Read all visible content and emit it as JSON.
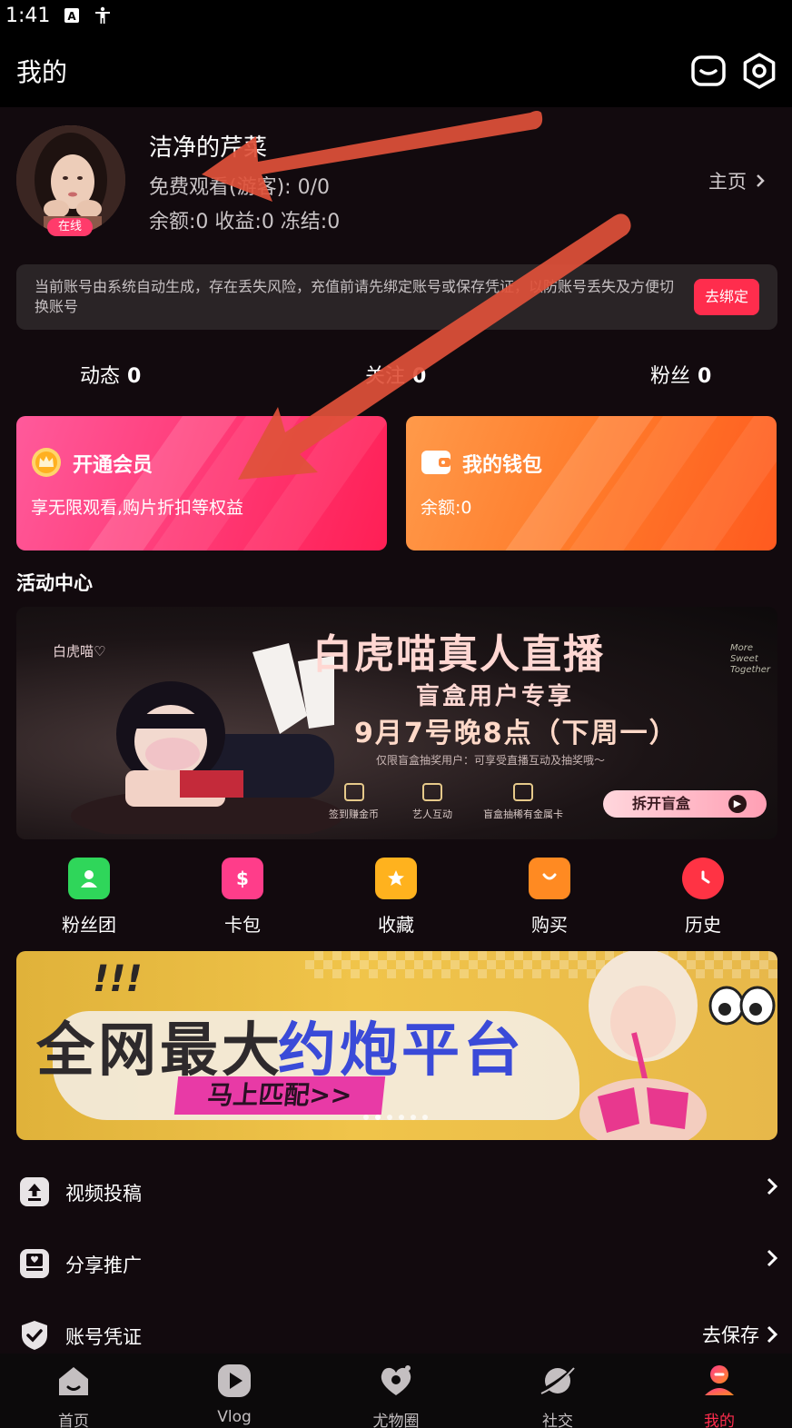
{
  "status_bar": {
    "time": "1:41"
  },
  "header": {
    "title": "我的"
  },
  "profile": {
    "nickname": "洁净的芹菜",
    "online_badge": "在线",
    "free_watch": "免费观看(游客): 0/0",
    "balance_line": "余额:0 收益:0 冻结:0",
    "homepage_label": "主页"
  },
  "notice": {
    "text": "当前账号由系统自动生成，存在丢失风险，充值前请先绑定账号或保存凭证，以防账号丢失及方便切换账号",
    "bind_label": "去绑定"
  },
  "stats": [
    {
      "label": "动态",
      "value": "0"
    },
    {
      "label": "关注",
      "value": "0"
    },
    {
      "label": "粉丝",
      "value": "0"
    }
  ],
  "vip_card": {
    "title": "开通会员",
    "subtitle": "享无限观看,购片折扣等权益"
  },
  "wallet_card": {
    "title": "我的钱包",
    "subtitle": "余额:0"
  },
  "activity": {
    "section_title": "活动中心",
    "banner1": {
      "title": "白虎喵真人直播",
      "subtitle": "盲盒用户专享",
      "date": "9月7号晚8点（下周一）",
      "note": "仅限盲盒抽奖用户：可享受直播互动及抽奖哦～",
      "features": [
        "签到赚金币",
        "艺人互动",
        "盲盒抽稀有金属卡"
      ],
      "button": "拆开盲盒",
      "side_script": "白虎喵♡",
      "side_script2": "More Sweet Together"
    }
  },
  "shortcuts": [
    {
      "label": "粉丝团",
      "icon": "fan-group-icon",
      "color": "#2fd65a"
    },
    {
      "label": "卡包",
      "icon": "card-wallet-icon",
      "color": "#ff3d8a"
    },
    {
      "label": "收藏",
      "icon": "favorite-icon",
      "color": "#ffb21e"
    },
    {
      "label": "购买",
      "icon": "shopping-bag-icon",
      "color": "#ff8a22"
    },
    {
      "label": "历史",
      "icon": "history-icon",
      "color": "#ff3344"
    }
  ],
  "banner2": {
    "text_left": "全网最大",
    "text_right": "约炮平台",
    "button": "马上匹配>>",
    "exclaim": "!!!",
    "slides": 6,
    "active_slide": 1
  },
  "menu": [
    {
      "label": "视频投稿",
      "icon": "upload-icon",
      "right": ""
    },
    {
      "label": "分享推广",
      "icon": "share-icon",
      "right": ""
    },
    {
      "label": "账号凭证",
      "icon": "shield-check-icon",
      "right": "去保存"
    }
  ],
  "tabbar": [
    {
      "label": "首页",
      "icon": "home-icon"
    },
    {
      "label": "Vlog",
      "icon": "play-icon"
    },
    {
      "label": "尤物圈",
      "icon": "heart-circle-icon"
    },
    {
      "label": "社交",
      "icon": "planet-icon"
    },
    {
      "label": "我的",
      "icon": "profile-icon",
      "active": true
    }
  ],
  "colors": {
    "accent": "#ff2d4d",
    "background": "#120a0e",
    "annotation_arrow": "#e0513a"
  }
}
